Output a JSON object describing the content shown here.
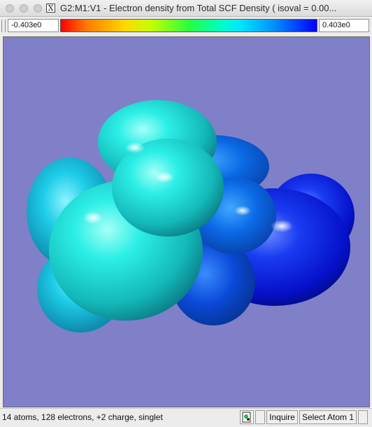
{
  "window": {
    "title": "G2:M1:V1 - Electron density from Total SCF Density ( isoval = 0.00...",
    "x_logo": "X"
  },
  "colorbar": {
    "min_label": "-0.403e0",
    "max_label": "0.403e0"
  },
  "viewport": {
    "background": "#8080c8",
    "surface_colors": [
      "#00e8e0",
      "#0a4cf0",
      "#0000ff"
    ]
  },
  "status": {
    "info": "14 atoms, 128 electrons, +2 charge, singlet",
    "inquire_label": "Inquire",
    "select_atom_label": "Select Atom 1",
    "icon": "molecule-view-icon"
  }
}
